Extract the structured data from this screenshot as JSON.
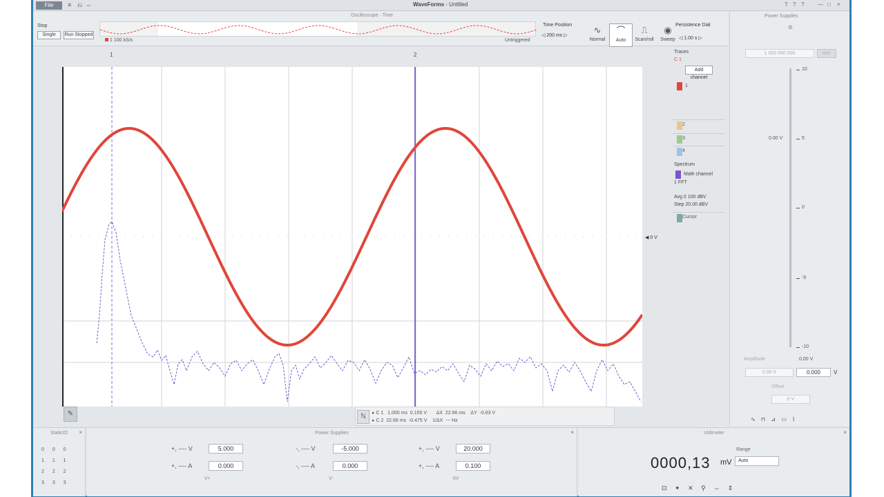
{
  "app": {
    "file_button": "File",
    "title_prefix": "WaveForms",
    "title_suffix": "- Untitled",
    "window_controls": [
      "?",
      "?",
      "?",
      "—",
      "□",
      "×"
    ]
  },
  "toolbar_icons": [
    "≡",
    "⎌",
    "⇔"
  ],
  "topstrip": {
    "title": "Oscilloscope · Time",
    "mode_label": "Stop",
    "mode_buttons": [
      "Single",
      "Run Stopped"
    ],
    "legend": "1 100 kS/s",
    "status": "Untriggered",
    "time_label": "Time Position",
    "time_value": "◁ 200 ms ▷",
    "trigger_buttons": [
      {
        "symbol": "∿",
        "label": "Normal"
      },
      {
        "symbol": "⌒",
        "label": "Auto"
      },
      {
        "symbol": "⎍",
        "label": "Scan/roll"
      },
      {
        "symbol": "◉",
        "label": "Sweep"
      }
    ],
    "trigger_label": "Persistence Dial",
    "trigger_value": "◁ 1.00 s ▷"
  },
  "plot": {
    "cursor_labels": [
      "1",
      "2"
    ],
    "ref_label": "◀ 0 V",
    "measurement_lines": [
      "▸ C 1   1.000 ms  0.155 V       ΔX  22.66 ms    ΔY  -0.63 V",
      "▸ C 2  22.66 ms  -0.475 V    1/ΔX  --- Hz"
    ],
    "pen_icon": "✎",
    "meas_icon": "ℕ"
  },
  "channels": {
    "header": "Traces",
    "ch1_label": "C 1",
    "ch1_button": "Add channel",
    "ch1_row_label": "1",
    "ch2_row_label": "2",
    "ch3_row_label": "3",
    "ch4_row_label": "4",
    "trace_section": "Spectrum",
    "trace_name": "Math channel",
    "trace_lines": [
      "1 FFT",
      "Avg 0 100 dBV",
      "Step 20.00 dBV"
    ],
    "math_row_label": "Cursor"
  },
  "rightpanel": {
    "title": "Power Supplies",
    "knob": "⊙",
    "field": "1 000 000 000",
    "unit_btn": "mV",
    "tick_labels": [
      "10",
      "5",
      "0",
      "-5",
      "-10"
    ],
    "slider_value": "0.00 V",
    "lower_label": "Amplitude",
    "lower_val": "0.00 V",
    "input1": "0.00 V",
    "input2": "0.000",
    "input2_unit": "V",
    "step_label": "Offset",
    "input3": "0 V",
    "bottom_row": "∿ ⊓ ⊿ ▭ ⌇"
  },
  "bottom": {
    "digital_title": "StaticIO",
    "digital_rows": [
      "0 0 0",
      "1 1 1",
      "2 2 2",
      "3 3 3"
    ],
    "psu_title": "Power Supplies",
    "psu": [
      {
        "v_label": "+, ---- V",
        "v_value": "5.000",
        "a_label": "+, ---- A",
        "a_value": "0.000",
        "cap": "V+"
      },
      {
        "v_label": "-, ---- V",
        "v_value": "-5.000",
        "a_label": "-, ---- A",
        "a_value": "0.000",
        "cap": "V-"
      },
      {
        "v_label": "+, ---- V",
        "v_value": "20.000",
        "a_label": "+, ---- A",
        "a_value": "0.100",
        "cap": "6V"
      }
    ],
    "dmm_title": "Voltmeter",
    "dmm_value": "0000,13",
    "dmm_unit": "mV",
    "dmm_mode_label": "Range",
    "dmm_mode": "Auto",
    "dmm_icons": "⊡ ✦ ✕ ⚲ ⇔ ⇕"
  },
  "chart_data": {
    "type": "line",
    "title": "",
    "xlabel": "",
    "ylabel": "",
    "grid": true,
    "series": [
      {
        "color": "#e0463a",
        "kind": "sine",
        "periods_visible": 1.83
      },
      {
        "color": "#7a55d0",
        "kind": "spectrum-noise"
      }
    ]
  }
}
